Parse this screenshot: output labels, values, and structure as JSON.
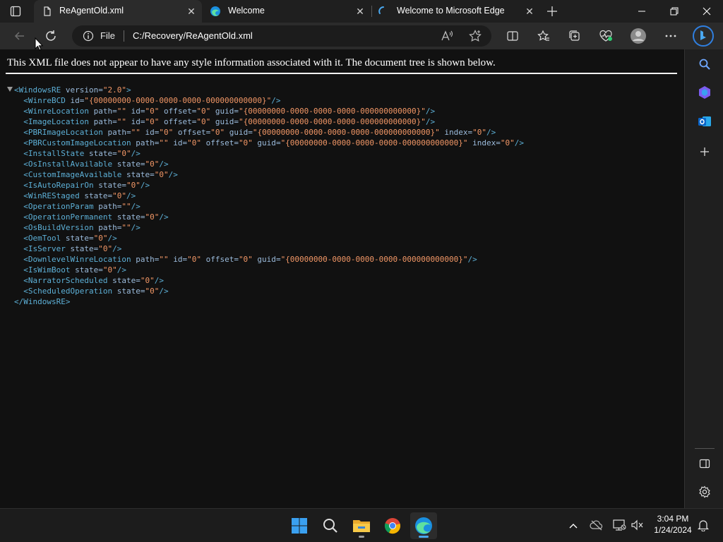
{
  "tabs": [
    {
      "title": "ReAgentOld.xml",
      "icon": "document-icon",
      "active": true
    },
    {
      "title": "Welcome",
      "icon": "edge-icon",
      "active": false
    },
    {
      "title": "Welcome to Microsoft Edge",
      "icon": "edge-loading-icon",
      "active": false
    }
  ],
  "address": {
    "scheme_label": "File",
    "url": "C:/Recovery/ReAgentOld.xml"
  },
  "xml_notice": "This XML file does not appear to have any style information associated with it. The document tree is shown below.",
  "xml_lines": [
    "<WindowsRE version=\"2.0\">",
    "  <WinreBCD id=\"{00000000-0000-0000-0000-000000000000}\"/>",
    "  <WinreLocation path=\"\" id=\"0\" offset=\"0\" guid=\"{00000000-0000-0000-0000-000000000000}\"/>",
    "  <ImageLocation path=\"\" id=\"0\" offset=\"0\" guid=\"{00000000-0000-0000-0000-000000000000}\"/>",
    "  <PBRImageLocation path=\"\" id=\"0\" offset=\"0\" guid=\"{00000000-0000-0000-0000-000000000000}\" index=\"0\"/>",
    "  <PBRCustomImageLocation path=\"\" id=\"0\" offset=\"0\" guid=\"{00000000-0000-0000-0000-000000000000}\" index=\"0\"/>",
    "  <InstallState state=\"0\"/>",
    "  <OsInstallAvailable state=\"0\"/>",
    "  <CustomImageAvailable state=\"0\"/>",
    "  <IsAutoRepairOn state=\"0\"/>",
    "  <WinREStaged state=\"0\"/>",
    "  <OperationParam path=\"\"/>",
    "  <OperationPermanent state=\"0\"/>",
    "  <OsBuildVersion path=\"\"/>",
    "  <OemTool state=\"0\"/>",
    "  <IsServer state=\"0\"/>",
    "  <DownlevelWinreLocation path=\"\" id=\"0\" offset=\"0\" guid=\"{00000000-0000-0000-0000-000000000000}\"/>",
    "  <IsWimBoot state=\"0\"/>",
    "  <NarratorScheduled state=\"0\"/>",
    "  <ScheduledOperation state=\"0\"/>",
    "</WindowsRE>"
  ],
  "toolbar_icons": [
    "back-icon",
    "refresh-icon",
    "info-icon",
    "read-aloud-icon",
    "favorite-star-icon",
    "split-screen-icon",
    "favorites-icon",
    "collections-icon",
    "browser-essentials-icon",
    "profile-avatar",
    "more-icon",
    "bing-copilot-icon"
  ],
  "sidebar_icons": [
    "search-icon",
    "copilot-icon",
    "outlook-icon",
    "add-icon",
    "hide-sidebar-icon",
    "settings-icon"
  ],
  "taskbar_icons": [
    "windows-start-icon",
    "search-icon",
    "file-explorer-icon",
    "chrome-icon",
    "edge-icon"
  ],
  "tray_icons": [
    "chevron-up-icon",
    "onedrive-icon",
    "network-icon",
    "volume-muted-icon",
    "notification-bell-icon"
  ],
  "clock": {
    "time": "3:04 PM",
    "date": "1/24/2024"
  },
  "colors": {
    "tag": "#5db0d7",
    "attr": "#9bbbdc",
    "value": "#f29766",
    "edge_blue": "#1a8fe0"
  }
}
